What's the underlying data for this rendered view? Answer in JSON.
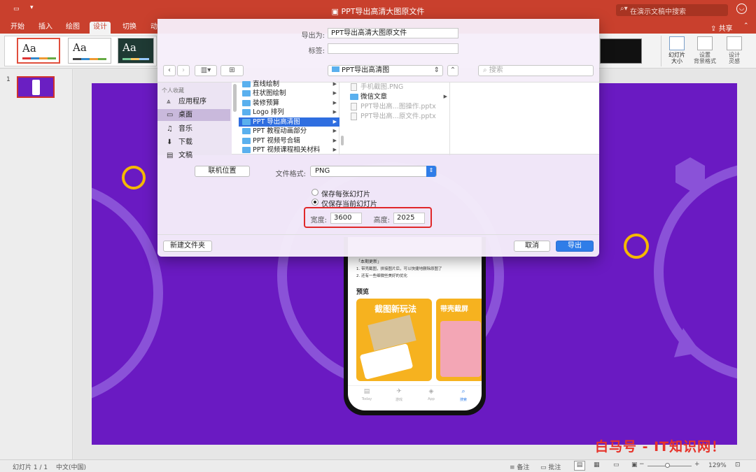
{
  "window": {
    "title": "PPT导出高清大图原文件",
    "search_placeholder": "在演示文稿中搜索",
    "share_label": "共享"
  },
  "ribbon": {
    "tabs": [
      "开始",
      "插入",
      "绘图",
      "设计",
      "切换",
      "动"
    ],
    "active_tab": "设计",
    "theme_label": "Aa",
    "buttons": [
      {
        "label": "幻灯片\n大小"
      },
      {
        "label": "设置\n背景格式"
      },
      {
        "label": "设计\n灵感"
      }
    ]
  },
  "slide_panel": {
    "slide_number": "1"
  },
  "dialog": {
    "export_as_label": "导出为:",
    "export_as_value": "PPT导出高清大图原文件",
    "tags_label": "标签:",
    "tags_value": "",
    "location": "PPT导出高清图",
    "search_placeholder": "搜索",
    "sidebar": {
      "header": "个人收藏",
      "items": [
        {
          "label": "应用程序",
          "icon": "apps-icon"
        },
        {
          "label": "桌面",
          "icon": "desktop-icon",
          "selected": true
        },
        {
          "label": "音乐",
          "icon": "music-icon"
        },
        {
          "label": "下载",
          "icon": "download-icon"
        },
        {
          "label": "文稿",
          "icon": "documents-icon"
        }
      ]
    },
    "column1": [
      "直线绘制",
      "柱状图绘制",
      "装修预算",
      "Logo 排列",
      "PPT 导出高清图",
      "PPT 教程动画部分",
      "PPT 视频号合辑",
      "PPT 视频课程相关材料"
    ],
    "column1_selected": "PPT 导出高清图",
    "column2": [
      {
        "label": "手机截图.PNG",
        "type": "file"
      },
      {
        "label": "微信文章",
        "type": "folder"
      },
      {
        "label": "PPT导出高...图操作.pptx",
        "type": "file"
      },
      {
        "label": "PPT导出高...原文件.pptx",
        "type": "file"
      }
    ],
    "online_location_button": "联机位置",
    "file_format_label": "文件格式:",
    "file_format_value": "PNG",
    "option_save_every": "保存每张幻灯片",
    "option_save_current": "仅保存当前幻灯片",
    "width_label": "宽度:",
    "width_value": "3600",
    "height_label": "高度:",
    "height_value": "2025",
    "new_folder_button": "新建文件夹",
    "cancel_button": "取消",
    "export_button": "导出"
  },
  "phone": {
    "update_title": "「本期更新」",
    "update_line1": "1. 带壳截图，拼接图片后，可以快捷地删除原图了",
    "update_line2": "2. 还有一些细微些美好的优化",
    "preview_label": "预览",
    "card1_title": "截图新玩法",
    "card2_title": "带壳截屏",
    "tabbar": [
      "Today",
      "游戏",
      "App",
      "搜索"
    ]
  },
  "statusbar": {
    "slide_info": "幻灯片 1 / 1",
    "language": "中文(中国)",
    "notes": "备注",
    "comments": "批注",
    "zoom": "129%"
  },
  "watermark": "白马号 - IT知识网！",
  "colors": {
    "titlebar": "#c9402d",
    "slide_bg": "#6a1ac2",
    "accent_yellow": "#f5b800",
    "selection_blue": "#2f6ee0",
    "highlight_red": "#e0282a"
  }
}
